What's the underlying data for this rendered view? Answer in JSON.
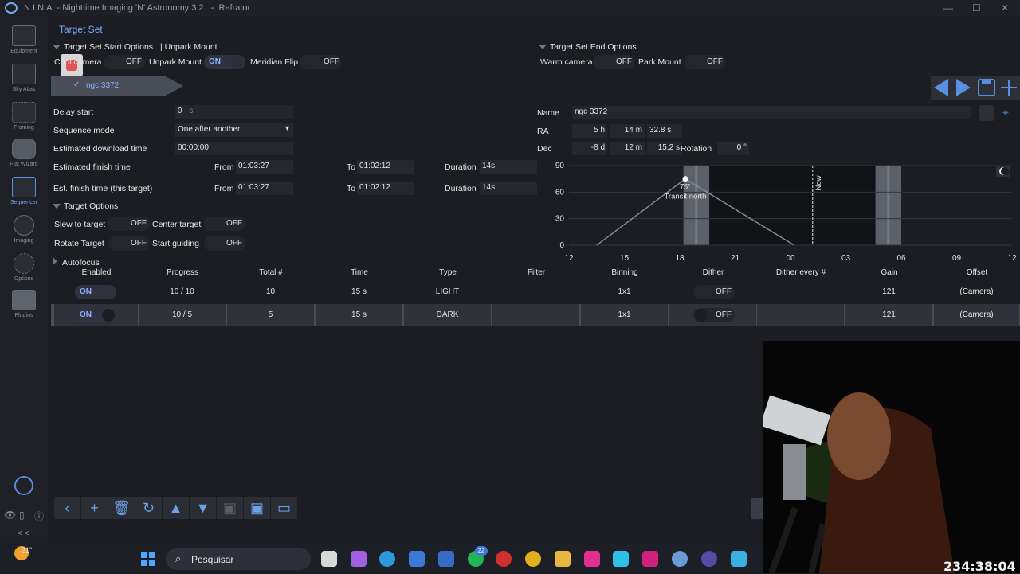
{
  "window": {
    "title": "N.I.N.A. - Nighttime Imaging 'N' Astronomy 3.2   -  Refrator"
  },
  "sidebar": {
    "items": [
      {
        "label": "Equipment"
      },
      {
        "label": "Sky Atlas"
      },
      {
        "label": "Framing"
      },
      {
        "label": "Flat Wizard"
      },
      {
        "label": "Sequencer"
      },
      {
        "label": "Imaging"
      },
      {
        "label": "Options"
      },
      {
        "label": "Plugins"
      }
    ],
    "collapse": "< <"
  },
  "header": {
    "tab": "Target Set",
    "start_options": "Target Set Start Options",
    "unpark_hdr": "| Unpark Mount",
    "end_options": "Target Set End Options",
    "cool_camera": "Cool camera",
    "unpark_mount": "Unpark Mount",
    "meridian_flip": "Meridian Flip",
    "warm_camera": "Warm camera",
    "park_mount": "Park Mount",
    "cool_val": "OFF",
    "unpark_val": "ON",
    "meridian_val": "OFF",
    "warm_val": "OFF",
    "park_val": "OFF"
  },
  "target_tab": {
    "name": "ngc 3372"
  },
  "settings": {
    "delay_start_label": "Delay start",
    "delay_start_value": "0",
    "delay_start_unit": "s",
    "sequence_mode_label": "Sequence mode",
    "sequence_mode_value": "One after another",
    "est_download_label": "Estimated download time",
    "est_download_value": "00:00:00",
    "est_finish_label": "Estimated finish time",
    "est_finish_target_label": "Est. finish time (this target)",
    "from_label": "From",
    "to_label": "To",
    "duration_label": "Duration",
    "finish_from": "01:03:27",
    "finish_to": "01:02:12",
    "finish_duration": "14s",
    "target_from": "01:03:27",
    "target_to": "01:02:12",
    "target_duration": "14s"
  },
  "target_options": {
    "title": "Target Options",
    "slew": "Slew to target",
    "slew_val": "OFF",
    "center": "Center target",
    "center_val": "OFF",
    "rotate": "Rotate Target",
    "rotate_val": "OFF",
    "guiding": "Start guiding",
    "guiding_val": "OFF",
    "autofocus": "Autofocus"
  },
  "coords": {
    "name_label": "Name",
    "name_value": "ngc 3372",
    "ra_label": "RA",
    "ra_h": "5",
    "ra_h_unit": "h",
    "ra_m": "14",
    "ra_m_unit": "m",
    "ra_s": "32.8",
    "ra_s_unit": "s",
    "dec_label": "Dec",
    "dec_d": "-8",
    "dec_d_unit": "d",
    "dec_m": "12",
    "dec_m_unit": "m",
    "dec_s": "15.2",
    "dec_s_unit": "s",
    "rotation_label": "Rotation",
    "rotation_value": "0",
    "rotation_unit": "°"
  },
  "chart_data": {
    "type": "line",
    "x_ticks": [
      "12",
      "15",
      "18",
      "21",
      "00",
      "03",
      "06",
      "09",
      "12"
    ],
    "y_ticks": [
      "0",
      "30",
      "60",
      "90"
    ],
    "ylim": [
      0,
      90
    ],
    "xlim_hours": [
      0,
      24
    ],
    "series": [
      {
        "x": [
          1.5,
          6.3,
          12.2
        ],
        "y": [
          0,
          75,
          0
        ]
      }
    ],
    "peak_label": "75°",
    "peak_caption": "Transit north",
    "now_label": "Now",
    "now_x": 13.2,
    "night_bands": [
      [
        6.2,
        7.6
      ],
      [
        16.6,
        18.0
      ]
    ],
    "dark_range": [
      7.6,
      16.6
    ]
  },
  "table": {
    "headers": [
      "Enabled",
      "Progress",
      "Total #",
      "Time",
      "Type",
      "Filter",
      "Binning",
      "Dither",
      "Dither every #",
      "Gain",
      "Offset"
    ],
    "rows": [
      {
        "enabled": "ON",
        "progress": "10 / 10",
        "total": "10",
        "time": "15 s",
        "type": "LIGHT",
        "filter": "",
        "binning": "1x1",
        "dither": "OFF",
        "dither_every": "",
        "gain": "121",
        "offset": "(Camera)"
      },
      {
        "enabled": "ON",
        "progress": "10 / 5",
        "total": "5",
        "time": "15 s",
        "type": "DARK",
        "filter": "",
        "binning": "1x1",
        "dither": "OFF",
        "dither_every": "",
        "gain": "121",
        "offset": "(Camera)"
      }
    ]
  },
  "taskbar": {
    "weather": "21°",
    "search_placeholder": "Pesquisar",
    "whatsapp_badge": "22"
  },
  "overlay": {
    "clock": "234:38:04"
  },
  "colors": {
    "accent": "#7aa8ff",
    "background": "#1b1d22",
    "panel": "#24272d"
  }
}
